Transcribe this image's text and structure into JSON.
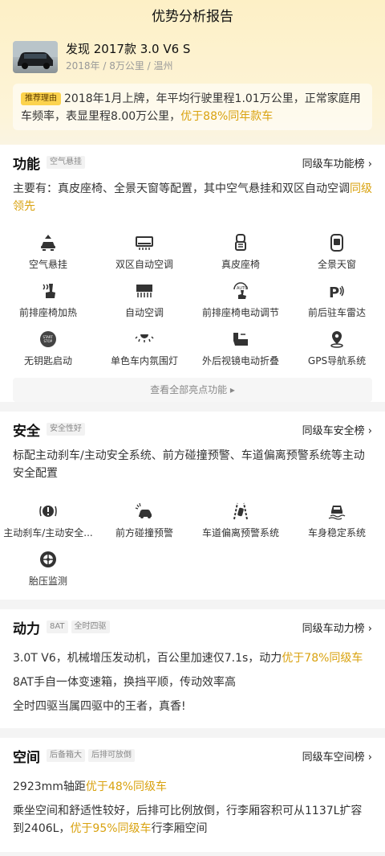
{
  "page_title": "优势分析报告",
  "car": {
    "name": "发现 2017款 3.0 V6 S",
    "meta": "2018年 / 8万公里 / 温州"
  },
  "reason": {
    "tag": "推荐理由",
    "text": "2018年1月上牌，年平均行驶里程1.01万公里，正常家庭用车频率，表显里程8.00万公里，",
    "highlight": "优于88%同年款车"
  },
  "features": {
    "title": "功能",
    "tag": "空气悬挂",
    "link": "同级车功能榜 ›",
    "desc": "主要有：真皮座椅、全景天窗等配置，其中空气悬挂和双区自动空调",
    "desc_highlight": "同级领先",
    "items": [
      {
        "label": "空气悬挂",
        "icon": "suspension-icon"
      },
      {
        "label": "双区自动空调",
        "icon": "ac-icon"
      },
      {
        "label": "真皮座椅",
        "icon": "seat-icon"
      },
      {
        "label": "全景天窗",
        "icon": "sunroof-icon"
      },
      {
        "label": "前排座椅加热",
        "icon": "seat-heat-icon"
      },
      {
        "label": "自动空调",
        "icon": "auto-ac-icon"
      },
      {
        "label": "前排座椅电动调节",
        "icon": "seat-adjust-icon"
      },
      {
        "label": "前后驻车雷达",
        "icon": "parking-radar-icon"
      },
      {
        "label": "无钥匙启动",
        "icon": "keyless-start-icon"
      },
      {
        "label": "单色车内氛围灯",
        "icon": "ambient-light-icon"
      },
      {
        "label": "外后视镜电动折叠",
        "icon": "mirror-fold-icon"
      },
      {
        "label": "GPS导航系统",
        "icon": "gps-icon"
      }
    ],
    "see_all": "查看全部亮点功能 ▸"
  },
  "safety": {
    "title": "安全",
    "tag": "安全性好",
    "link": "同级车安全榜 ›",
    "desc": "标配主动刹车/主动安全系统、前方碰撞预警、车道偏离预警系统等主动安全配置",
    "items": [
      {
        "label": "主动刹车/主动安全...",
        "icon": "brake-warning-icon"
      },
      {
        "label": "前方碰撞预警",
        "icon": "collision-warning-icon"
      },
      {
        "label": "车道偏离预警系统",
        "icon": "lane-departure-icon"
      },
      {
        "label": "车身稳定系统",
        "icon": "stability-icon"
      },
      {
        "label": "胎压监测",
        "icon": "tire-pressure-icon"
      }
    ]
  },
  "power": {
    "title": "动力",
    "tags": [
      "8AT",
      "全时四驱"
    ],
    "link": "同级车动力榜 ›",
    "line1": "3.0T V6，机械增压发动机，百公里加速仅7.1s，动力",
    "line1_highlight": "优于78%同级车",
    "line2": "8AT手自一体变速箱，换挡平顺，传动效率高",
    "line3": "全时四驱当属四驱中的王者，真香!"
  },
  "space": {
    "title": "空间",
    "tags": [
      "后备箱大",
      "后排可放倒"
    ],
    "link": "同级车空间榜 ›",
    "line1": "2923mm轴距",
    "line1_highlight": "优于48%同级车",
    "line2": "乘坐空间和舒适性较好，后排可比例放倒，行李厢容积可从1137L扩容到2406L，",
    "line2_highlight": "优于95%同级车",
    "line2_tail": "行李厢空间"
  },
  "colors": {
    "accent": "#d9a20f",
    "tag_bg": "#fcd34d"
  }
}
